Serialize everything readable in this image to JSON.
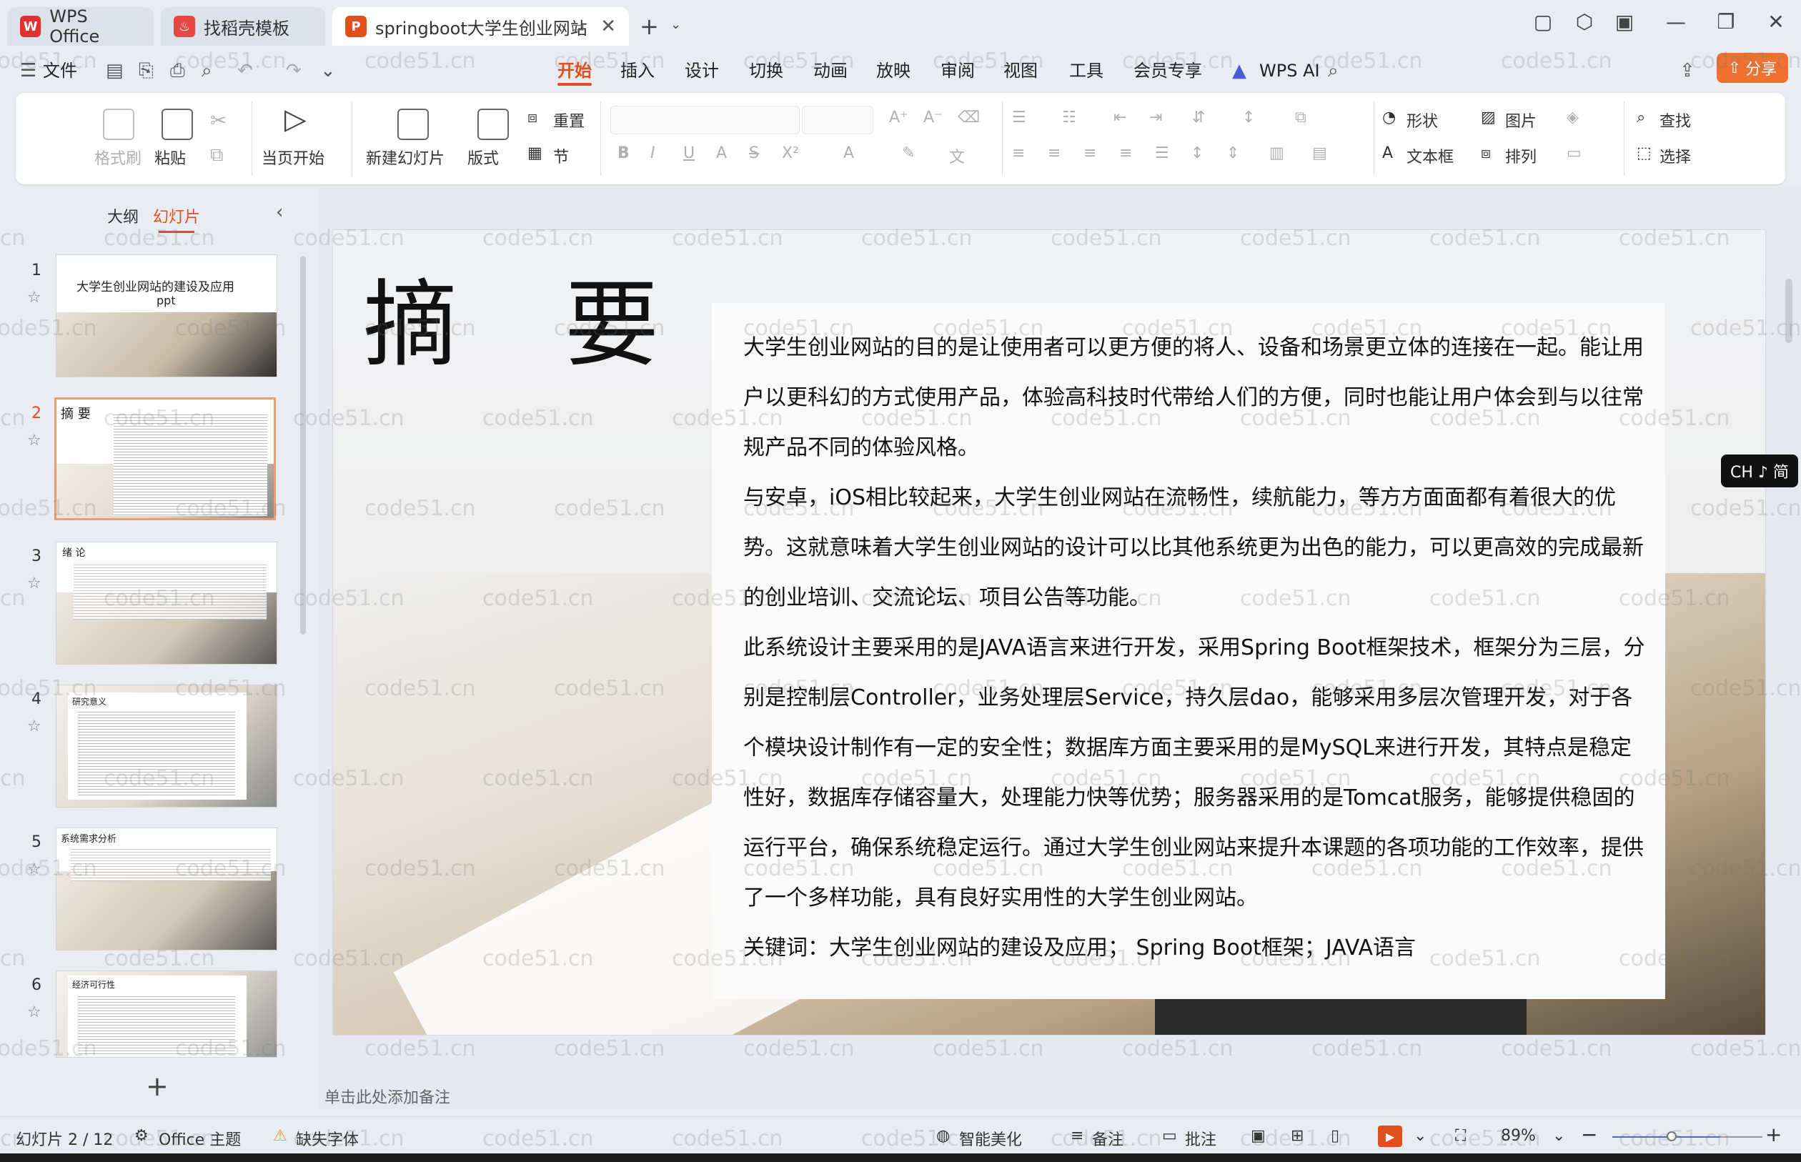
{
  "tabs": {
    "t1": "WPS Office",
    "t2": "找稻壳模板",
    "t3": "springboot大学生创业网站"
  },
  "menu": {
    "file": "文件",
    "items": [
      "开始",
      "插入",
      "设计",
      "切换",
      "动画",
      "放映",
      "审阅",
      "视图",
      "工具",
      "会员专享"
    ],
    "wps_ai": "WPS AI",
    "share": "分享"
  },
  "ribbon": {
    "format_brush": "格式刷",
    "paste": "粘贴",
    "play_current": "当页开始",
    "new_slide": "新建幻灯片",
    "layout": "版式",
    "reset": "重置",
    "section": "节",
    "shape": "形状",
    "picture": "图片",
    "find": "查找",
    "textbox": "文本框",
    "arrange": "排列",
    "select": "选择"
  },
  "panel": {
    "outline": "大纲",
    "slides": "幻灯片",
    "slide_numbers": [
      "1",
      "2",
      "3",
      "4",
      "5",
      "6"
    ],
    "thumb1_title": "大学生创业网站的建设及应用",
    "thumb1_sub": "ppt",
    "thumb2_title": "摘 要",
    "thumb3_title": "绪 论",
    "thumb4_title": "研究意义",
    "thumb5_title": "系统需求分析",
    "thumb6_title": "经济可行性"
  },
  "slide": {
    "title": "摘要",
    "p1": "大学生创业网站的目的是让使用者可以更方便的将人、设备和场景更立体的连接在一起。能让用户以更科幻的方式使用产品，体验高科技时代带给人们的方便，同时也能让用户体会到与以往常规产品不同的体验风格。",
    "p2": "与安卓，iOS相比较起来，大学生创业网站在流畅性，续航能力，等方方面面都有着很大的优势。这就意味着大学生创业网站的设计可以比其他系统更为出色的能力，可以更高效的完成最新的创业培训、交流论坛、项目公告等功能。",
    "p3": "此系统设计主要采用的是JAVA语言来进行开发，采用Spring Boot框架技术，框架分为三层，分别是控制层Controller，业务处理层Service，持久层dao，能够采用多层次管理开发，对于各个模块设计制作有一定的安全性；数据库方面主要采用的是MySQL来进行开发，其特点是稳定性好，数据库存储容量大，处理能力快等优势；服务器采用的是Tomcat服务，能够提供稳固的运行平台，确保系统稳定运行。通过大学生创业网站来提升本课题的各项功能的工作效率，提供了一个多样功能，具有良好实用性的大学生创业网站。",
    "keywords": "关键词：大学生创业网站的建设及应用； Spring Boot框架；JAVA语言"
  },
  "ime": "CH ♪ 简",
  "notes_placeholder": "单击此处添加备注",
  "status": {
    "slide_count": "幻灯片 2 / 12",
    "theme": "Office 主题",
    "missing_font": "缺失字体",
    "beautify": "智能美化",
    "notes": "备注",
    "comments": "批注",
    "zoom": "89%"
  },
  "watermark": "code51.cn",
  "colors": {
    "accent": "#e0501e",
    "share_button": "#f07030"
  }
}
